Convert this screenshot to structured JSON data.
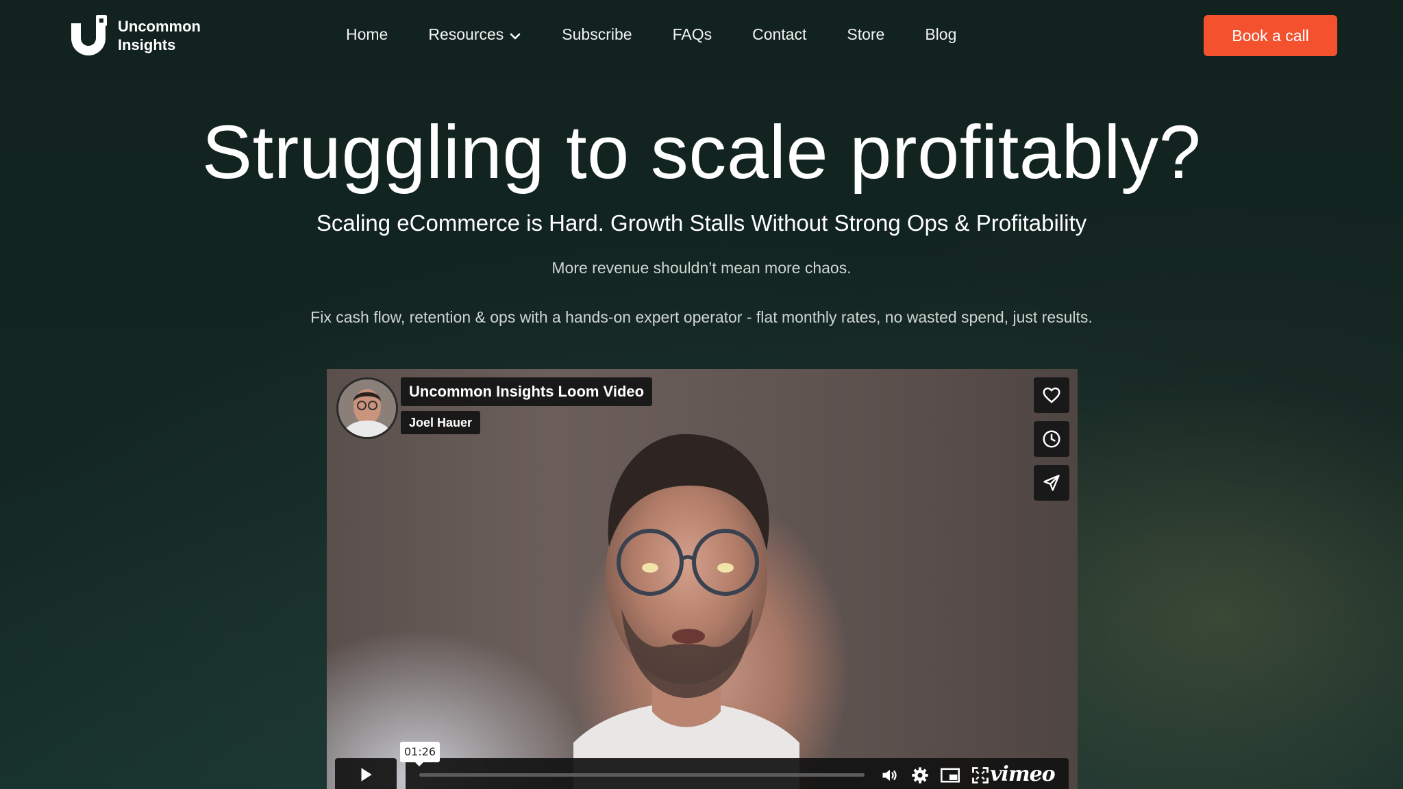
{
  "brand": {
    "line1": "Uncommon",
    "line2": "Insights"
  },
  "nav": {
    "items": [
      {
        "label": "Home"
      },
      {
        "label": "Resources"
      },
      {
        "label": "Subscribe"
      },
      {
        "label": "FAQs"
      },
      {
        "label": "Contact"
      },
      {
        "label": "Store"
      },
      {
        "label": "Blog"
      }
    ],
    "cta": "Book a call"
  },
  "hero": {
    "title": "Struggling to scale profitably?",
    "subtitle": "Scaling eCommerce is Hard. Growth Stalls Without Strong Ops & Profitability",
    "line1": "More revenue shouldn’t mean more chaos.",
    "line2": "Fix cash flow, retention & ops with a hands-on expert operator - flat monthly rates, no wasted spend, just results."
  },
  "video": {
    "title": "Uncommon Insights Loom Video",
    "author": "Joel Hauer",
    "timestamp": "01:26",
    "provider": "vimeo",
    "progress": 0,
    "side_icons": [
      "heart-icon",
      "clock-icon",
      "send-icon"
    ],
    "control_icons": [
      "volume-icon",
      "gear-icon",
      "pip-icon",
      "fullscreen-icon"
    ]
  },
  "colors": {
    "background": "#132623",
    "accent": "#f4522f",
    "text": "#ffffff",
    "muted_text": "#cfd6d3"
  }
}
